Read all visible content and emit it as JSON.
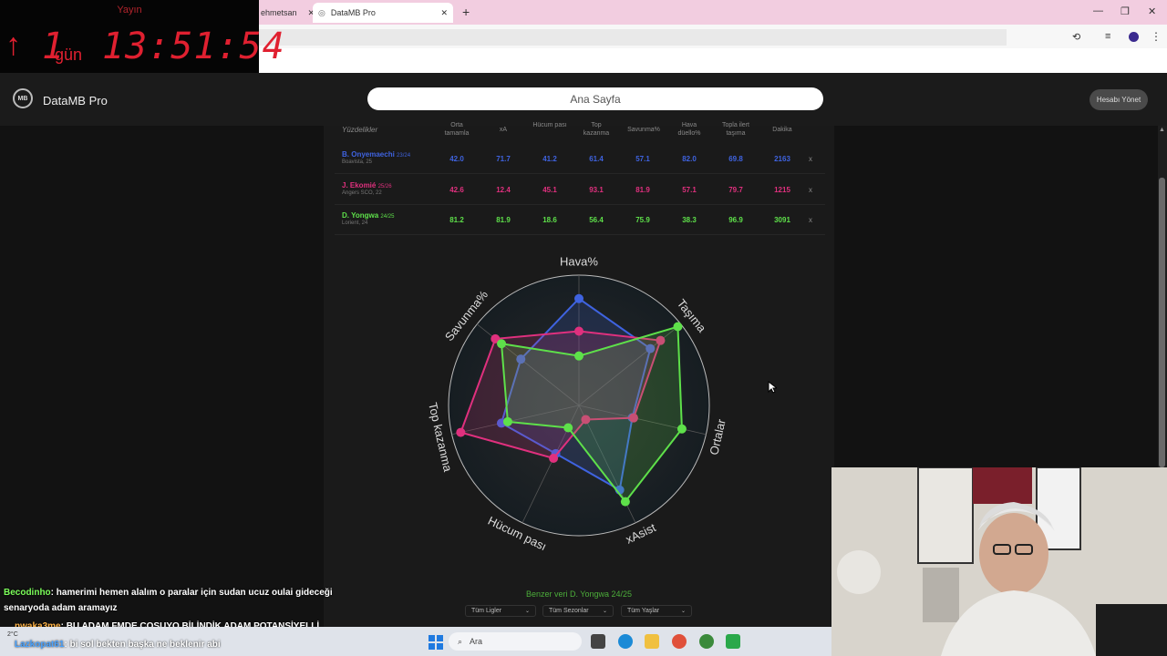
{
  "browser": {
    "tabs": [
      {
        "label": "ehmetsan"
      },
      {
        "label": "DataMB Pro"
      }
    ]
  },
  "stream_timer": {
    "label": "Yayın",
    "days": "1",
    "days_unit": "gün",
    "clock": "13:51:54"
  },
  "app": {
    "name": "DataMB Pro",
    "logo_text": "MB",
    "search_placeholder": "Ana Sayfa",
    "account_button": "Hesabı Yönet"
  },
  "table": {
    "headers": [
      "Yüzdelikler",
      "Orta tamamla",
      "xA",
      "Hücum pası",
      "Top kazanma",
      "Savunma%",
      "Hava düello%",
      "Topla ilert taşıma",
      "Dakika"
    ],
    "rows": [
      {
        "name": "B. Onyemaechi",
        "season": "23/24",
        "club": "Boavista, 25",
        "values": [
          "42.0",
          "71.7",
          "41.2",
          "61.4",
          "57.1",
          "82.0",
          "69.8",
          "2163"
        ],
        "color": "#3f63e0",
        "remove": "x"
      },
      {
        "name": "J. Ekomié",
        "season": "25/26",
        "club": "Angers SCO, 22",
        "values": [
          "42.6",
          "12.4",
          "45.1",
          "93.1",
          "81.9",
          "57.1",
          "79.7",
          "1215"
        ],
        "color": "#e0307e",
        "remove": "x"
      },
      {
        "name": "D. Yongwa",
        "season": "24/25",
        "club": "Lorient, 24",
        "values": [
          "81.2",
          "81.9",
          "18.6",
          "56.4",
          "75.9",
          "38.3",
          "96.9",
          "3091"
        ],
        "color": "#5ee04a",
        "remove": "x"
      }
    ]
  },
  "chart_data": {
    "type": "radar",
    "axes": [
      "Hava%",
      "Taşıma",
      "Ortalar",
      "xAsist",
      "Hücum pası",
      "Top kazanma",
      "Savunma%"
    ],
    "range": [
      0,
      100
    ],
    "series": [
      {
        "name": "B. Onyemaechi",
        "values": [
          82,
          70,
          42,
          72,
          41,
          61,
          57
        ],
        "color": "#3f63e0"
      },
      {
        "name": "J. Ekomié",
        "values": [
          57,
          80,
          43,
          12,
          45,
          93,
          82
        ],
        "color": "#e0307e"
      },
      {
        "name": "D. Yongwa",
        "values": [
          38,
          97,
          81,
          82,
          19,
          56,
          76
        ],
        "color": "#5ee04a"
      }
    ]
  },
  "similar": {
    "title": "Benzer veri D. Yongwa 24/25",
    "filters": [
      "Tüm Ligler",
      "Tüm Sezonlar",
      "Tüm Yaşlar"
    ]
  },
  "chat": [
    {
      "user": "Becodinho",
      "user_color": "#7cff5a",
      "text": ": hamerimi hemen alalım o paralar için sudan ucuz oulai gideceği",
      "text2": "senaryoda adam aramayız"
    },
    {
      "user": "nwaka3me",
      "user_color": "#ffb347",
      "text": ": BU ADAM FMDE COŞUYO BİLİNDİK ADAM POTANSİYELLİ"
    },
    {
      "user": "Lazkopat61",
      "user_color": "#4aa3ff",
      "text": ": bi sol bekten başka ne beklenir abi"
    }
  ],
  "taskbar": {
    "search_label": "Ara",
    "weather": "2°C"
  }
}
